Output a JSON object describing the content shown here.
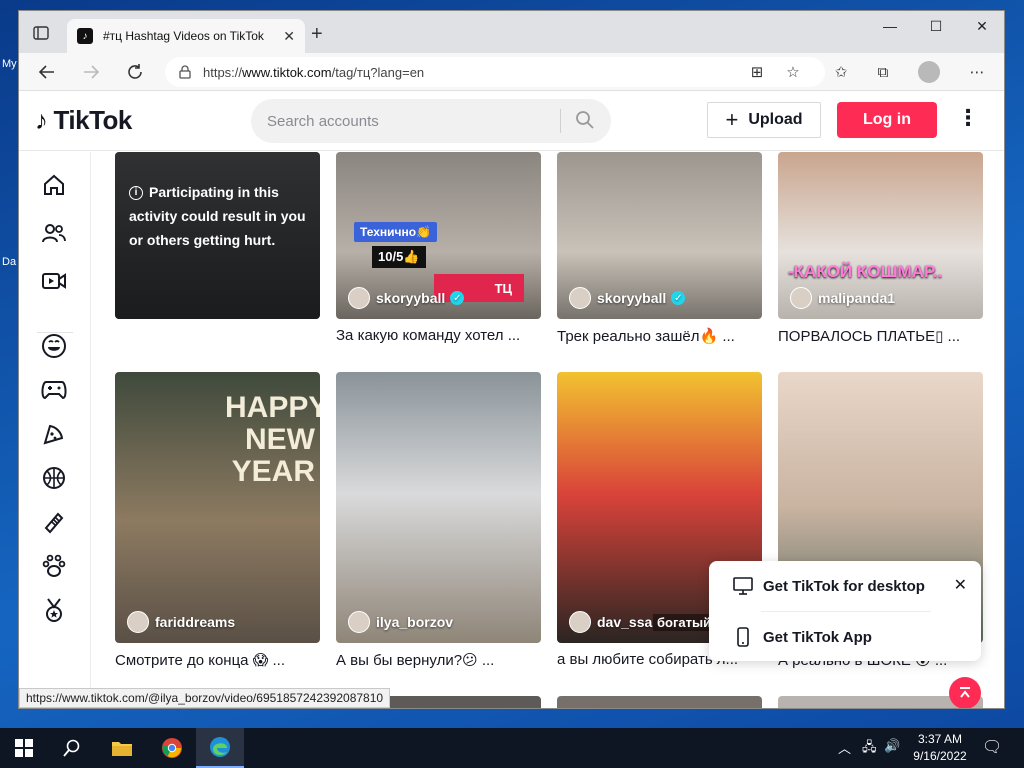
{
  "desktop": {
    "labels": [
      "My",
      "Da"
    ]
  },
  "browser": {
    "tab_title": "#тц Hashtag Videos on TikTok",
    "tab_close": "✕",
    "new_tab": "+",
    "controls": {
      "minimize": "—",
      "maximize": "☐",
      "close": "✕"
    },
    "url_prefix": "https://",
    "url_host": "www.tiktok.com",
    "url_path": "/tag/тц?lang=en"
  },
  "header": {
    "logo": "TikTok",
    "search_placeholder": "Search accounts",
    "upload_label": "Upload",
    "login_label": "Log in"
  },
  "sidebar": {
    "icons": [
      "home-icon",
      "following-icon",
      "live-icon",
      "comedy-icon",
      "gaming-icon",
      "food-icon",
      "sports-icon",
      "beauty-icon",
      "animals-icon",
      "achievement-icon"
    ]
  },
  "videos": {
    "row1": [
      {
        "author": "",
        "desc": "",
        "warning": "Participating in this activity could result in you or others getting hurt."
      },
      {
        "author": "skoryyball",
        "verified": true,
        "desc": "За какую команду хотел ...",
        "overlay_1": "Технично👏",
        "overlay_2": "10/5👍",
        "overlay_3": "ТЦ"
      },
      {
        "author": "skoryyball",
        "verified": true,
        "desc": "Трек реально зашёл🔥 ..."
      },
      {
        "author": "malipanda1",
        "verified": false,
        "desc": "ПОРВАЛОСЬ ПЛАТЬЕ▯ ...",
        "overlay_1": "-КАКОЙ КОШМАР.."
      }
    ],
    "row2": [
      {
        "author": "fariddreams",
        "desc": "Смотрите до конца 😱 ...",
        "overlay_1": "HAPPY NEW YEAR"
      },
      {
        "author": "ilya_borzov",
        "desc": "А вы бы вернули?😕 ..."
      },
      {
        "author": "dav_ssa",
        "desc": "а вы любите собирать л...",
        "overlay_1": "богатый"
      },
      {
        "author": "",
        "desc": "А реально в ШОКЕ 😮 ..."
      }
    ]
  },
  "popup": {
    "desktop_label": "Get TikTok for desktop",
    "app_label": "Get TikTok App"
  },
  "statusbar": {
    "url": "https://www.tiktok.com/@ilya_borzov/video/6951857242392087810"
  },
  "taskbar": {
    "time": "3:37 AM",
    "date": "9/16/2022"
  }
}
